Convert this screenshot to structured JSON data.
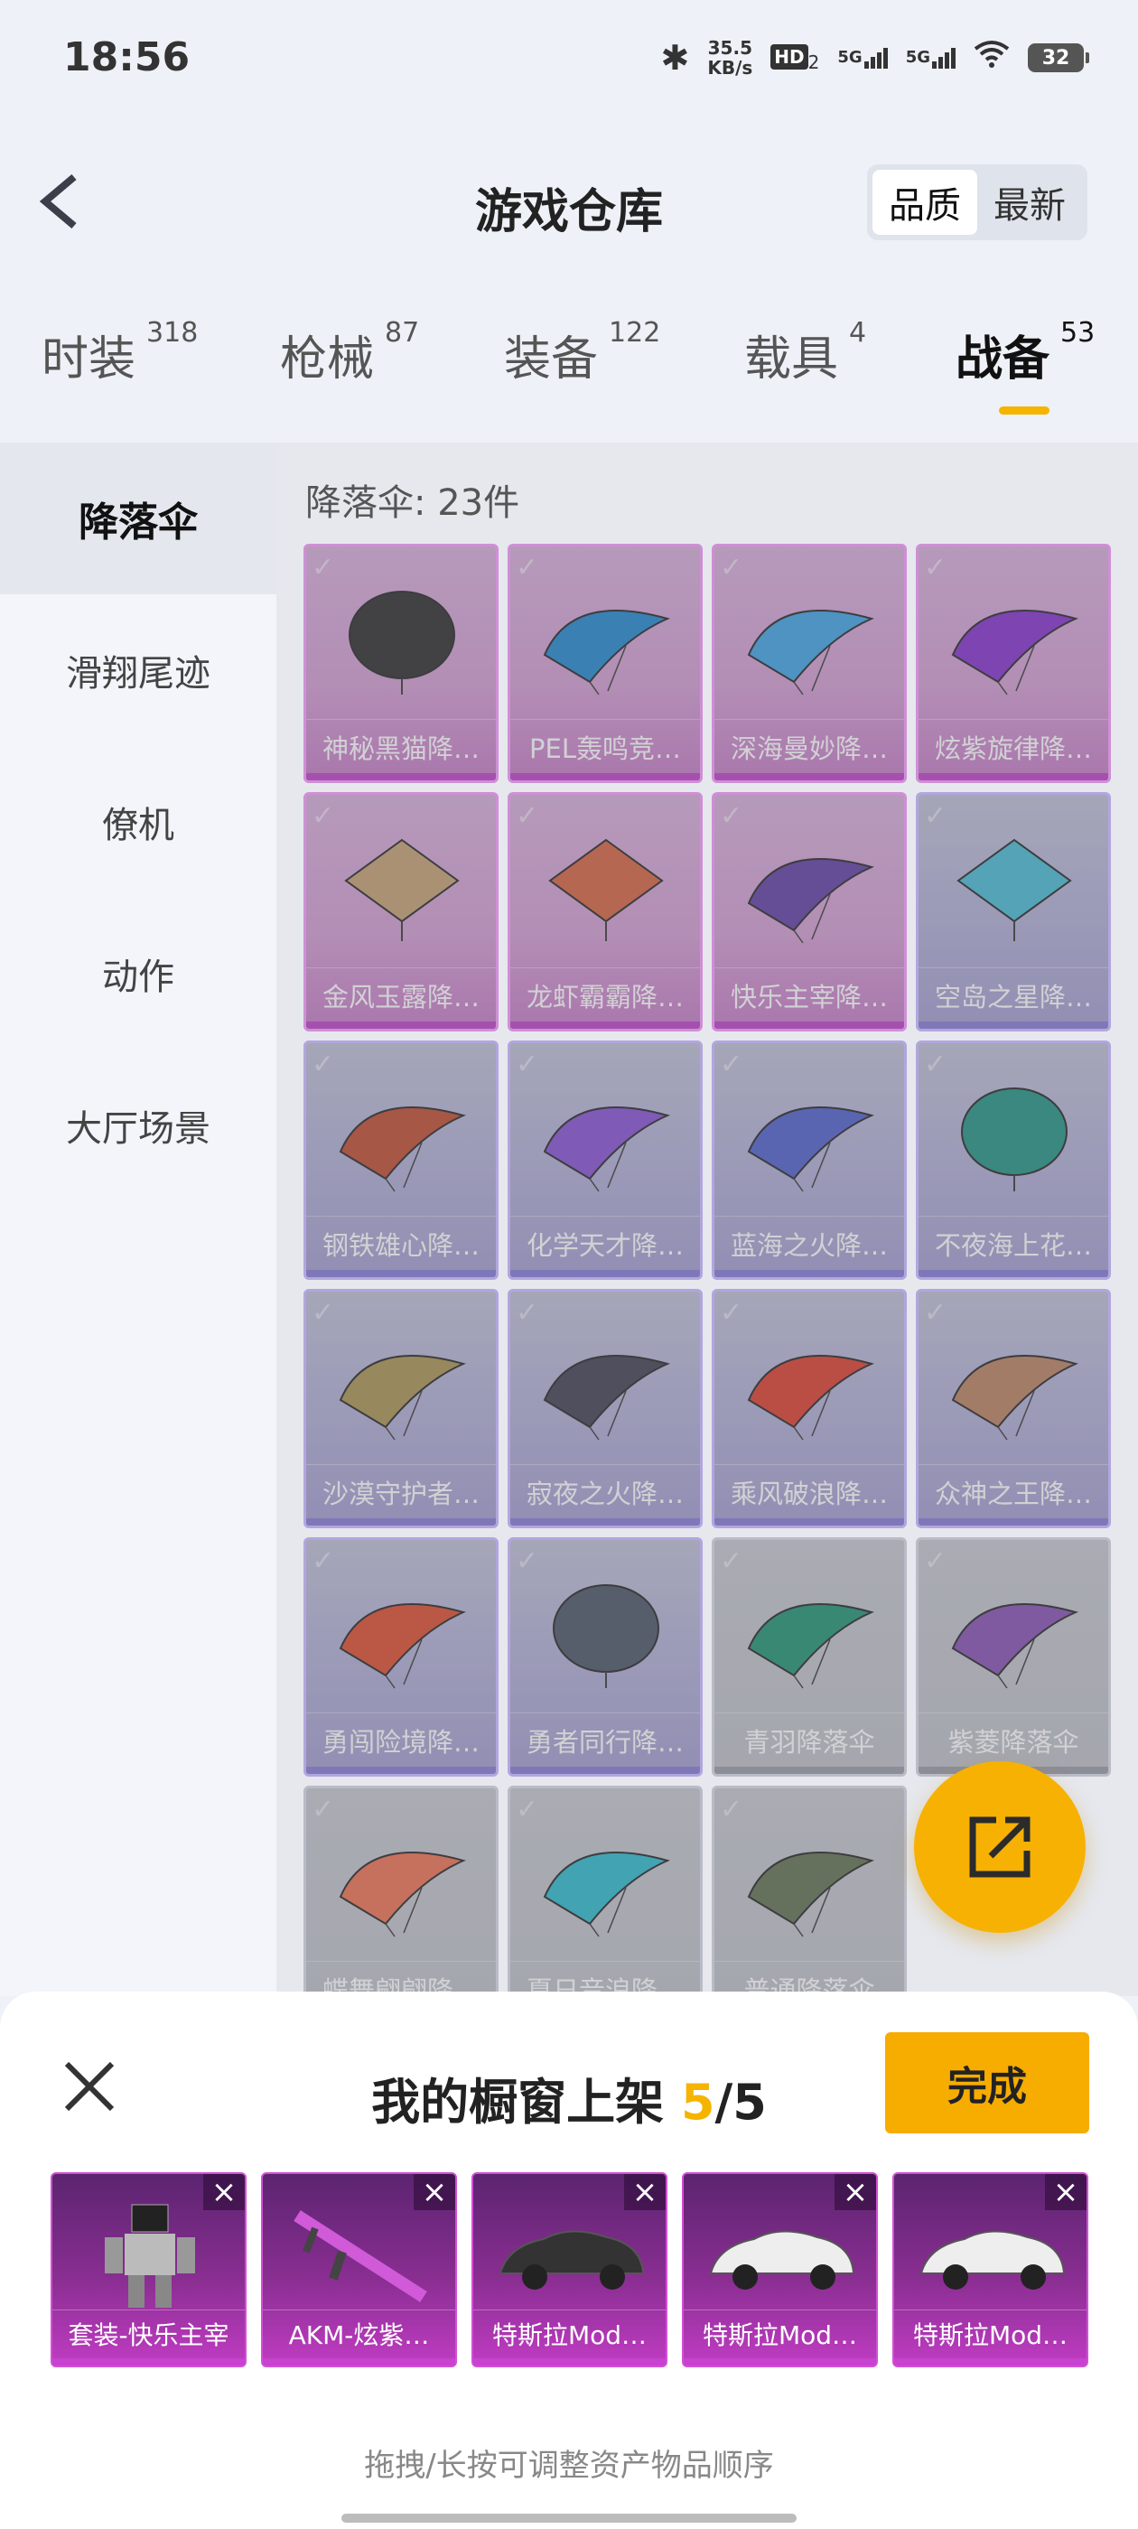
{
  "status_bar": {
    "time": "18:56",
    "net_speed_value": "35.5",
    "net_speed_unit": "KB/s",
    "hd_badge": "HD",
    "hd_sub": "2",
    "signal_1": "5G",
    "signal_2": "5G",
    "battery": "32",
    "icons": [
      "bluetooth-icon",
      "hd-voice-icon",
      "signal-icon",
      "signal-icon",
      "wifi-icon",
      "battery-icon"
    ]
  },
  "header": {
    "title": "游戏仓库",
    "back_icon": "chevron-left-icon",
    "sort_options": [
      "品质",
      "最新"
    ],
    "sort_selected": "品质"
  },
  "tabs": [
    {
      "label": "时装",
      "count": "318"
    },
    {
      "label": "枪械",
      "count": "87"
    },
    {
      "label": "装备",
      "count": "122"
    },
    {
      "label": "载具",
      "count": "4"
    },
    {
      "label": "战备",
      "count": "53",
      "active": true
    }
  ],
  "sidebar": {
    "items": [
      "降落伞",
      "滑翔尾迹",
      "僚机",
      "动作",
      "大厅场景"
    ],
    "active": "降落伞"
  },
  "main": {
    "count_label": "降落伞: 23件",
    "items": [
      {
        "name": "神秘黑猫降…",
        "rarity": "pink",
        "icon": "black-cat-parachute-icon"
      },
      {
        "name": "PEL轰鸣竞…",
        "rarity": "pink",
        "icon": "parachute-icon"
      },
      {
        "name": "深海曼妙降…",
        "rarity": "pink",
        "icon": "parachute-icon"
      },
      {
        "name": "炫紫旋律降…",
        "rarity": "pink",
        "icon": "parachute-icon"
      },
      {
        "name": "金风玉露降…",
        "rarity": "pink",
        "icon": "square-parachute-icon"
      },
      {
        "name": "龙虾霸霸降…",
        "rarity": "pink",
        "icon": "square-parachute-icon"
      },
      {
        "name": "快乐主宰降…",
        "rarity": "pink",
        "icon": "parachute-icon"
      },
      {
        "name": "空岛之星降…",
        "rarity": "lav",
        "icon": "square-parachute-icon"
      },
      {
        "name": "钢铁雄心降…",
        "rarity": "lav",
        "icon": "parachute-icon"
      },
      {
        "name": "化学天才降…",
        "rarity": "lav",
        "icon": "parachute-icon"
      },
      {
        "name": "蓝海之火降…",
        "rarity": "lav",
        "icon": "parachute-icon"
      },
      {
        "name": "不夜海上花…",
        "rarity": "lav",
        "icon": "round-parachute-icon"
      },
      {
        "name": "沙漠守护者…",
        "rarity": "lav",
        "icon": "parachute-icon"
      },
      {
        "name": "寂夜之火降…",
        "rarity": "lav",
        "icon": "parachute-icon"
      },
      {
        "name": "乘风破浪降…",
        "rarity": "lav",
        "icon": "parachute-icon"
      },
      {
        "name": "众神之王降…",
        "rarity": "lav",
        "icon": "parachute-icon"
      },
      {
        "name": "勇闯险境降…",
        "rarity": "lav",
        "icon": "parachute-icon"
      },
      {
        "name": "勇者同行降…",
        "rarity": "lav",
        "icon": "round-parachute-icon"
      },
      {
        "name": "青羽降落伞",
        "rarity": "grey",
        "icon": "parachute-icon"
      },
      {
        "name": "紫菱降落伞",
        "rarity": "grey",
        "icon": "parachute-icon"
      },
      {
        "name": "蝶舞翩翩降…",
        "rarity": "grey",
        "icon": "parachute-icon"
      },
      {
        "name": "夏日音浪降…",
        "rarity": "grey",
        "icon": "parachute-icon"
      },
      {
        "name": "普通降落伞",
        "rarity": "grey",
        "icon": "parachute-icon"
      }
    ]
  },
  "share_icon": "share-icon",
  "showcase": {
    "title_prefix": "我的橱窗上架 ",
    "current": "5",
    "sep_total": "/5",
    "done_label": "完成",
    "close_icon": "close-icon",
    "slots": [
      {
        "name": "套装-快乐主宰",
        "icon": "robot-outfit-icon"
      },
      {
        "name": "AKM-炫紫…",
        "icon": "rifle-icon"
      },
      {
        "name": "特斯拉Mod…",
        "icon": "car-icon"
      },
      {
        "name": "特斯拉Mod…",
        "icon": "car-icon"
      },
      {
        "name": "特斯拉Mod…",
        "icon": "car-icon"
      }
    ],
    "hint": "拖拽/长按可调整资产物品顺序"
  },
  "colors": {
    "accent": "#f5b400",
    "pink_rarity": "#c34dcc",
    "lavender_rarity": "#8d84d9",
    "grey_rarity": "#9ea1ab"
  }
}
